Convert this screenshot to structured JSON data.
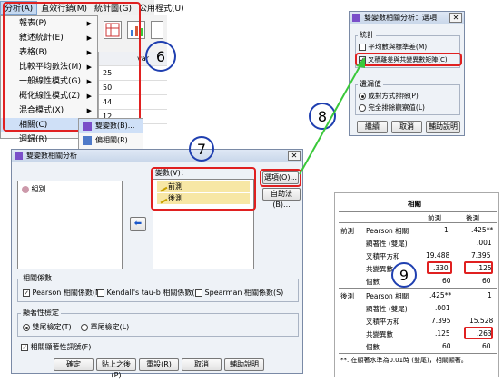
{
  "menubar": {
    "items": [
      "分析(A)",
      "直效行銷(M)",
      "統計圖(G)",
      "公用程式(U)"
    ]
  },
  "analyze_menu": {
    "items": [
      {
        "label": "報表(P)",
        "sub": true
      },
      {
        "label": "敘述統計(E)",
        "sub": true
      },
      {
        "label": "表格(B)",
        "sub": true
      },
      {
        "label": "比較平均數法(M)",
        "sub": true
      },
      {
        "label": "一般線性模式(G)",
        "sub": true
      },
      {
        "label": "概化線性模式(Z)",
        "sub": true
      },
      {
        "label": "混合模式(X)",
        "sub": true
      },
      {
        "label": "相關(C)",
        "sub": true
      },
      {
        "label": "迴歸(R)",
        "sub": true
      }
    ]
  },
  "grid": {
    "header": "var",
    "rows": [
      "25",
      "50",
      "44",
      "12"
    ]
  },
  "submenu": {
    "items": [
      "雙變數(B)...",
      "偏相關(R)..."
    ]
  },
  "steps": {
    "s6": "6",
    "s7": "7",
    "s8": "8",
    "s9": "9"
  },
  "main_dialog": {
    "title": "雙變數相關分析",
    "source_var": "組別",
    "vars_label": "變數(V)：",
    "vars": [
      "前測",
      "後測"
    ],
    "options_btn": "選項(O)...",
    "bootstrap_btn": "自助法(B)...",
    "coef_group": "相關係數",
    "coef_opts": [
      {
        "label": "Pearson 相關係數(N)",
        "checked": true
      },
      {
        "label": "Kendall's tau-b 相關係數(K)",
        "checked": false
      },
      {
        "label": "Spearman 相關係數(S)",
        "checked": false
      }
    ],
    "test_group": "顯著性檢定",
    "test_opts": [
      {
        "label": "雙尾檢定(T)",
        "on": true
      },
      {
        "label": "單尾檢定(L)",
        "on": false
      }
    ],
    "flag_label": "相關顯著性訊號(F)",
    "buttons": [
      "確定",
      "貼上之後(P)",
      "重設(R)",
      "取消",
      "輔助說明"
    ]
  },
  "options_dialog": {
    "title": "雙變數相關分析：選項",
    "stats_group": "統計",
    "stats_opts": [
      {
        "label": "平均數與標準差(M)",
        "checked": false
      },
      {
        "label": "叉積離差與共變異數矩陣(C)",
        "checked": true
      }
    ],
    "missing_group": "遺漏值",
    "missing_opts": [
      {
        "label": "成對方式排除(P)",
        "on": true
      },
      {
        "label": "完全排除觀察值(L)",
        "on": false
      }
    ],
    "buttons": [
      "繼續",
      "取消",
      "輔助說明"
    ]
  },
  "output": {
    "title": "相關",
    "col_headers": [
      "前測",
      "後測"
    ],
    "row_groups": [
      "前測",
      "後測"
    ],
    "stat_labels": [
      "Pearson 相關",
      "顯著性 (雙尾)",
      "叉積平方和",
      "共變異數",
      "個數"
    ],
    "pre": [
      [
        "1",
        ".425**"
      ],
      [
        "",
        ".001"
      ],
      [
        "19.488",
        "7.395"
      ],
      [
        ".330",
        ".125"
      ],
      [
        "60",
        "60"
      ]
    ],
    "post": [
      [
        ".425**",
        "1"
      ],
      [
        ".001",
        ""
      ],
      [
        "7.395",
        "15.528"
      ],
      [
        ".125",
        ".263"
      ],
      [
        "60",
        "60"
      ]
    ],
    "footnote": "**. 在顯著水準為0.01時 (雙尾)，相關顯著。"
  },
  "colors": {
    "accent_red": "#e02020",
    "arrow_green": "#3ac83a",
    "circle_blue": "#1f3fb0"
  }
}
